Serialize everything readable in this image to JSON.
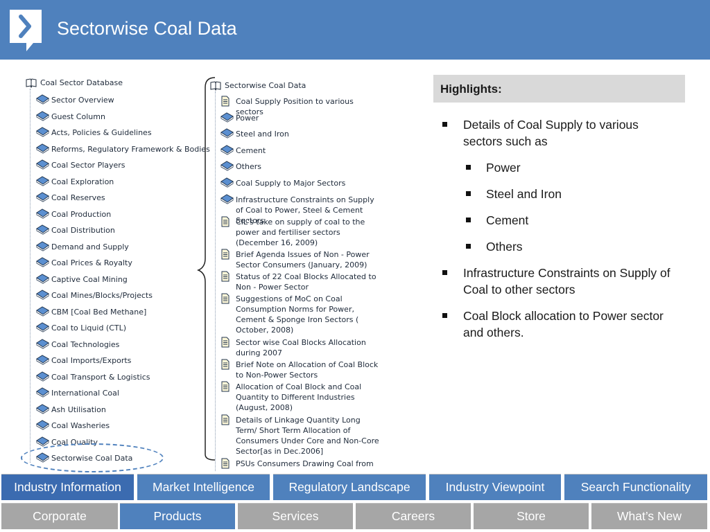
{
  "header": {
    "title": "Sectorwise Coal Data"
  },
  "left_tree": {
    "root": "Coal Sector Database",
    "items": [
      "Sector Overview",
      "Guest Column",
      "Acts, Policies & Guidelines",
      "Reforms, Regulatory Framework & Bodies",
      "Coal Sector Players",
      "Coal Exploration",
      "Coal Reserves",
      "Coal Production",
      "Coal Distribution",
      "Demand and Supply",
      "Coal Prices & Royalty",
      "Captive Coal Mining",
      "Coal Mines/Blocks/Projects",
      "CBM [Coal Bed Methane]",
      "Coal to Liquid (CTL)",
      "Coal Technologies",
      "Coal Imports/Exports",
      "Coal Transport & Logistics",
      "International Coal",
      "Ash Utilisation",
      "Coal Washeries",
      "Coal Quality",
      "Sectorwise Coal Data"
    ]
  },
  "right_tree": {
    "root": "Sectorwise Coal Data",
    "items": [
      {
        "label": "Coal Supply Position to various sectors",
        "icon": "document-icon"
      },
      {
        "label": "Power",
        "icon": "book-icon"
      },
      {
        "label": "Steel and Iron",
        "icon": "book-icon"
      },
      {
        "label": "Cement",
        "icon": "book-icon"
      },
      {
        "label": "Others",
        "icon": "book-icon"
      },
      {
        "label": "Coal Supply to Major Sectors",
        "icon": "book-icon"
      },
      {
        "label": "Infrastructure Constraints on Supply of Coal to Power, Steel & Cement Sectors",
        "icon": "book-icon"
      },
      {
        "label": "CIL's take on supply of coal to the power and fertiliser sectors (December 16, 2009)",
        "icon": "document-icon"
      },
      {
        "label": "Brief Agenda Issues of Non - Power Sector Consumers (January, 2009)",
        "icon": "document-icon"
      },
      {
        "label": "Status of 22 Coal Blocks Allocated to Non - Power Sector",
        "icon": "document-icon"
      },
      {
        "label": "Suggestions of MoC on Coal Consumption Norms for Power, Cement & Sponge Iron Sectors ( October, 2008)",
        "icon": "document-icon"
      },
      {
        "label": "Sector wise Coal Blocks Allocation during 2007",
        "icon": "document-icon"
      },
      {
        "label": "Brief Note on Allocation of Coal Block to Non-Power Sectors",
        "icon": "document-icon"
      },
      {
        "label": "Allocation of Coal Block and Coal Quantity to Different Industries (August, 2008)",
        "icon": "document-icon"
      },
      {
        "label": "Details of Linkage Quantity Long Term/ Short Term Allocation of Consumers Under Core and Non-Core Sector[as in Dec.2006]",
        "icon": "document-icon"
      },
      {
        "label": "PSUs Consumers Drawing Coal from",
        "icon": "document-icon"
      }
    ]
  },
  "highlights": {
    "title": "Highlights:",
    "bullets": [
      {
        "text": "Details of Coal Supply to various sectors such as",
        "level": 1
      },
      {
        "text": "Power",
        "level": 2
      },
      {
        "text": "Steel and Iron",
        "level": 2
      },
      {
        "text": "Cement",
        "level": 2
      },
      {
        "text": "Others",
        "level": 2
      },
      {
        "text": "Infrastructure Constraints on Supply of Coal to other sectors",
        "level": 1
      },
      {
        "text": "Coal Block allocation to Power sector and others.",
        "level": 1
      }
    ]
  },
  "nav_top": {
    "active": "Industry Information",
    "tabs": [
      "Industry Information",
      "Market Intelligence",
      "Regulatory Landscape",
      "Industry Viewpoint",
      "Search Functionality"
    ]
  },
  "nav_bottom": {
    "active": "Products",
    "tabs": [
      "Corporate",
      "Products",
      "Services",
      "Careers",
      "Store",
      "What’s New"
    ]
  },
  "colors": {
    "header_blue": "#4f81bd",
    "tab_active_blue": "#3b6bb0",
    "tab_gray": "#a6a6a6",
    "highlight_box": "#d9d9d9"
  }
}
